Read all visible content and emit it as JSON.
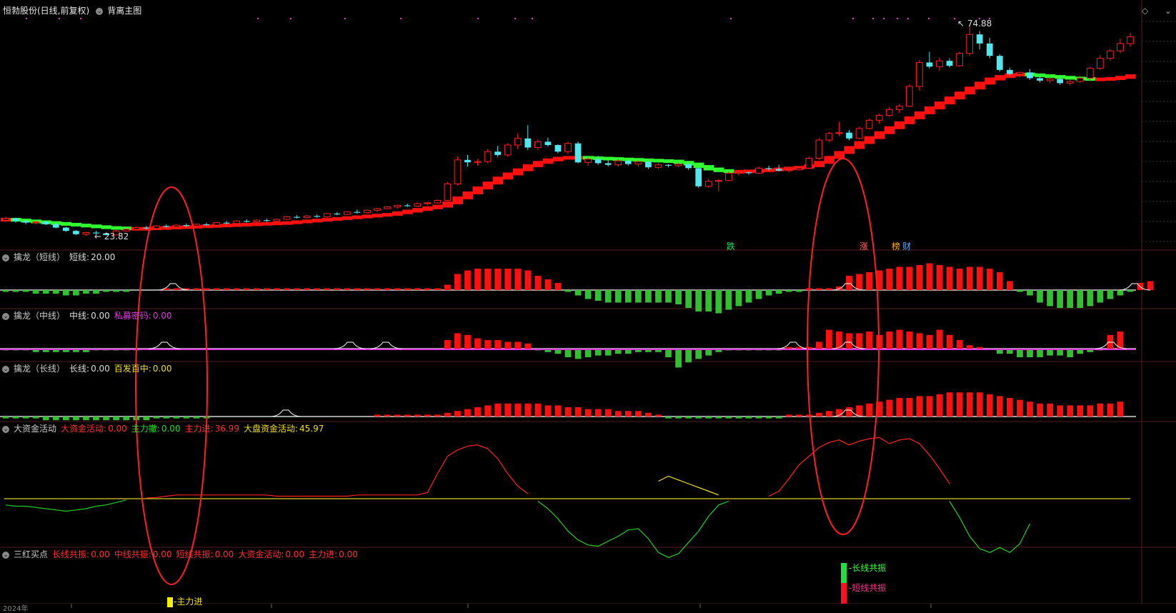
{
  "main": {
    "title": "恒勃股份(日线,前复权)",
    "overlay_label": "背离主图",
    "high_label": "74.88",
    "low_label": "23.82",
    "signals": [
      {
        "text": "跌",
        "color": "#1fdc5a"
      },
      {
        "text": "涨",
        "color": "#ff6a6a"
      },
      {
        "text": "榜",
        "color": "#ffb020"
      },
      {
        "text": "财",
        "color": "#5aa8ff"
      }
    ]
  },
  "panels": {
    "short": {
      "name": "擒龙（短线）",
      "items": [
        {
          "label": "短线:",
          "value": "20.00",
          "color": "#dddddd"
        }
      ]
    },
    "mid": {
      "name": "擒龙（中线）",
      "items": [
        {
          "label": "中线:",
          "value": "0.00",
          "color": "#dddddd"
        },
        {
          "label": "私募密码:",
          "value": "0.00",
          "color": "#e038e0"
        }
      ]
    },
    "long": {
      "name": "擒龙（长线）",
      "items": [
        {
          "label": "长线:",
          "value": "0.00",
          "color": "#dddddd"
        },
        {
          "label": "百发百中:",
          "value": "0.00",
          "color": "#f0e020"
        }
      ]
    },
    "funds": {
      "name": "大资金活动",
      "items": [
        {
          "label": "大资金活动:",
          "value": "0.00",
          "color": "#ff3030"
        },
        {
          "label": "主力撤:",
          "value": "0.00",
          "color": "#20e020"
        },
        {
          "label": "主力进:",
          "value": "36.99",
          "color": "#ff3030"
        },
        {
          "label": "大盘资金活动:",
          "value": "45.97",
          "color": "#f0e020"
        }
      ]
    },
    "buy": {
      "name": "三红买点",
      "items": [
        {
          "label": "长线共振:",
          "value": "0.00",
          "color": "#ff3030"
        },
        {
          "label": "中线共振:",
          "value": "0.00",
          "color": "#ff3030"
        },
        {
          "label": "短线共振:",
          "value": "0.00",
          "color": "#ff3030"
        },
        {
          "label": "大资金活动:",
          "value": "0.00",
          "color": "#ff3030"
        },
        {
          "label": "主力进:",
          "value": "0.00",
          "color": "#ff3030"
        }
      ]
    }
  },
  "legend": {
    "main_in": "-主力进",
    "long_res": "-长线共振",
    "short_res": "-短线共振"
  },
  "bottom_axis": {
    "year": "2024年"
  },
  "colors": {
    "up": "#ff2020",
    "down": "#50e8f0",
    "ma_up": "#ff1010",
    "ma_down": "#30ff30",
    "ellipse": "#ff2020"
  },
  "chart_data": {
    "type": "candlestick",
    "price_range": [
      23.82,
      74.88
    ],
    "candles": [
      [
        27.6,
        28.4,
        27.2,
        28.0
      ],
      [
        28.0,
        28.2,
        27.0,
        27.4
      ],
      [
        27.4,
        27.6,
        26.6,
        27.0
      ],
      [
        27.0,
        27.4,
        26.6,
        27.2
      ],
      [
        27.2,
        27.4,
        26.4,
        26.6
      ],
      [
        26.6,
        26.8,
        25.6,
        25.8
      ],
      [
        25.8,
        26.0,
        24.8,
        25.0
      ],
      [
        25.0,
        25.2,
        24.0,
        24.2
      ],
      [
        24.2,
        24.8,
        23.82,
        24.6
      ],
      [
        24.6,
        25.0,
        24.0,
        24.4
      ],
      [
        24.4,
        24.6,
        23.9,
        24.0
      ],
      [
        24.0,
        25.2,
        23.9,
        25.0
      ],
      [
        25.0,
        25.6,
        24.8,
        25.4
      ],
      [
        25.4,
        26.0,
        25.2,
        25.8
      ],
      [
        25.8,
        26.2,
        25.4,
        25.6
      ],
      [
        25.6,
        26.4,
        25.4,
        26.2
      ],
      [
        26.2,
        26.6,
        25.8,
        26.0
      ],
      [
        26.0,
        26.6,
        25.8,
        26.4
      ],
      [
        26.4,
        26.8,
        26.0,
        26.2
      ],
      [
        26.2,
        26.8,
        26.0,
        26.6
      ],
      [
        26.6,
        27.0,
        26.2,
        26.4
      ],
      [
        26.4,
        27.2,
        26.2,
        27.0
      ],
      [
        27.0,
        27.4,
        26.6,
        26.8
      ],
      [
        26.8,
        27.6,
        26.6,
        27.4
      ],
      [
        27.4,
        27.8,
        27.0,
        27.2
      ],
      [
        27.2,
        27.8,
        27.0,
        27.6
      ],
      [
        27.6,
        28.0,
        27.2,
        27.4
      ],
      [
        27.4,
        28.0,
        27.2,
        27.8
      ],
      [
        27.8,
        28.6,
        27.6,
        28.4
      ],
      [
        28.4,
        28.8,
        28.0,
        28.2
      ],
      [
        28.2,
        28.8,
        28.0,
        28.6
      ],
      [
        28.6,
        29.0,
        28.2,
        28.4
      ],
      [
        28.4,
        29.4,
        28.2,
        29.2
      ],
      [
        29.2,
        29.6,
        28.8,
        29.0
      ],
      [
        29.0,
        29.8,
        28.8,
        29.6
      ],
      [
        29.6,
        30.2,
        29.2,
        29.4
      ],
      [
        29.4,
        30.2,
        29.2,
        30.0
      ],
      [
        30.0,
        30.6,
        29.6,
        30.4
      ],
      [
        30.4,
        31.0,
        30.2,
        30.8
      ],
      [
        30.8,
        31.4,
        30.4,
        31.2
      ],
      [
        31.2,
        31.6,
        30.8,
        31.0
      ],
      [
        31.0,
        31.8,
        30.8,
        31.6
      ],
      [
        31.6,
        32.0,
        31.2,
        31.8
      ],
      [
        31.8,
        32.6,
        31.6,
        32.4
      ],
      [
        32.4,
        36.8,
        32.2,
        36.4
      ],
      [
        36.4,
        43.0,
        36.0,
        42.2
      ],
      [
        42.2,
        43.4,
        40.6,
        41.6
      ],
      [
        41.6,
        42.4,
        40.8,
        41.8
      ],
      [
        41.8,
        44.8,
        41.4,
        44.2
      ],
      [
        44.2,
        45.6,
        43.0,
        43.4
      ],
      [
        43.4,
        46.2,
        43.0,
        45.8
      ],
      [
        45.8,
        48.6,
        44.8,
        47.4
      ],
      [
        47.4,
        50.6,
        44.6,
        45.2
      ],
      [
        45.2,
        47.2,
        44.6,
        46.6
      ],
      [
        46.6,
        47.6,
        45.4,
        45.8
      ],
      [
        45.8,
        46.0,
        43.8,
        44.2
      ],
      [
        44.2,
        46.6,
        43.6,
        46.2
      ],
      [
        46.2,
        46.6,
        41.4,
        41.6
      ],
      [
        41.6,
        42.8,
        40.8,
        42.4
      ],
      [
        42.4,
        43.2,
        41.0,
        41.4
      ],
      [
        41.4,
        42.2,
        40.6,
        41.0
      ],
      [
        41.0,
        42.4,
        40.6,
        42.0
      ],
      [
        42.0,
        42.4,
        40.8,
        41.2
      ],
      [
        41.2,
        42.0,
        40.6,
        41.8
      ],
      [
        41.8,
        42.0,
        40.0,
        40.4
      ],
      [
        40.4,
        41.4,
        40.0,
        41.0
      ],
      [
        41.0,
        41.2,
        40.4,
        40.8
      ],
      [
        40.8,
        41.6,
        40.4,
        41.2
      ],
      [
        41.2,
        41.4,
        39.8,
        40.2
      ],
      [
        40.2,
        40.4,
        35.4,
        35.8
      ],
      [
        35.8,
        37.6,
        35.4,
        37.0
      ],
      [
        37.0,
        37.6,
        34.6,
        37.2
      ],
      [
        37.2,
        39.4,
        37.0,
        39.0
      ],
      [
        39.0,
        39.8,
        38.4,
        39.2
      ],
      [
        39.2,
        39.4,
        38.6,
        39.0
      ],
      [
        39.0,
        40.6,
        38.8,
        40.2
      ],
      [
        40.2,
        40.8,
        39.6,
        40.0
      ],
      [
        40.0,
        41.0,
        39.4,
        39.6
      ],
      [
        39.6,
        40.2,
        39.2,
        39.8
      ],
      [
        39.8,
        40.6,
        39.6,
        40.2
      ],
      [
        40.2,
        43.0,
        40.0,
        42.6
      ],
      [
        42.6,
        47.4,
        42.2,
        47.0
      ],
      [
        47.0,
        49.0,
        46.6,
        48.6
      ],
      [
        48.6,
        51.4,
        48.0,
        48.8
      ],
      [
        48.8,
        49.4,
        47.0,
        47.4
      ],
      [
        47.4,
        50.2,
        47.2,
        49.8
      ],
      [
        49.8,
        52.2,
        49.6,
        51.8
      ],
      [
        51.8,
        53.4,
        51.0,
        53.0
      ],
      [
        53.0,
        55.0,
        52.6,
        54.4
      ],
      [
        54.4,
        55.8,
        53.6,
        55.2
      ],
      [
        55.2,
        60.6,
        55.0,
        60.0
      ],
      [
        60.0,
        66.4,
        59.0,
        65.8
      ],
      [
        65.8,
        68.4,
        64.4,
        64.8
      ],
      [
        64.8,
        67.0,
        63.8,
        66.2
      ],
      [
        66.2,
        66.8,
        64.6,
        65.0
      ],
      [
        65.0,
        68.4,
        64.8,
        68.0
      ],
      [
        68.0,
        74.88,
        67.4,
        72.6
      ],
      [
        72.6,
        73.4,
        69.0,
        70.4
      ],
      [
        70.4,
        71.8,
        66.8,
        67.4
      ],
      [
        67.4,
        67.8,
        63.6,
        64.0
      ],
      [
        64.0,
        64.6,
        62.6,
        63.0
      ],
      [
        63.0,
        63.6,
        62.2,
        63.4
      ],
      [
        63.4,
        64.2,
        61.6,
        62.0
      ],
      [
        62.0,
        62.6,
        61.0,
        61.4
      ],
      [
        61.4,
        62.2,
        60.8,
        61.8
      ],
      [
        61.8,
        62.4,
        60.4,
        60.8
      ],
      [
        60.8,
        61.6,
        60.2,
        61.2
      ],
      [
        61.2,
        62.6,
        60.8,
        62.0
      ],
      [
        62.0,
        64.8,
        61.2,
        64.4
      ],
      [
        64.4,
        67.6,
        64.0,
        66.8
      ],
      [
        66.8,
        69.0,
        66.2,
        68.6
      ],
      [
        68.6,
        71.6,
        68.0,
        70.4
      ],
      [
        70.4,
        73.0,
        69.6,
        72.0
      ]
    ],
    "ma_line": [
      27.8,
      27.6,
      27.4,
      27.2,
      27.0,
      26.8,
      26.6,
      26.4,
      26.2,
      26.0,
      25.8,
      25.7,
      25.6,
      25.6,
      25.6,
      25.7,
      25.8,
      25.9,
      26.0,
      26.1,
      26.2,
      26.3,
      26.4,
      26.5,
      26.6,
      26.7,
      26.8,
      26.9,
      27.0,
      27.2,
      27.4,
      27.6,
      27.8,
      28.0,
      28.2,
      28.4,
      28.6,
      28.8,
      29.0,
      29.4,
      29.8,
      30.2,
      30.6,
      31.0,
      31.8,
      33.0,
      34.2,
      35.4,
      36.6,
      37.8,
      38.8,
      39.8,
      40.8,
      41.6,
      42.2,
      42.6,
      42.8,
      42.8,
      42.7,
      42.6,
      42.5,
      42.4,
      42.3,
      42.2,
      42.1,
      42.0,
      41.9,
      41.6,
      41.2,
      40.6,
      40.0,
      39.6,
      39.4,
      39.4,
      39.5,
      39.6,
      39.8,
      40.0,
      40.2,
      40.4,
      40.8,
      41.6,
      42.8,
      44.0,
      45.2,
      46.4,
      47.6,
      48.8,
      50.0,
      51.2,
      52.4,
      53.6,
      54.8,
      56.0,
      57.2,
      58.4,
      59.6,
      60.8,
      61.8,
      62.4,
      62.8,
      63.0,
      62.8,
      62.6,
      62.4,
      62.2,
      62.0,
      61.9,
      61.8,
      61.8,
      61.9,
      62.2,
      62.6,
      63.0,
      63.4
    ],
    "short_bars": [
      -1,
      -1,
      -1,
      -2,
      -2,
      -2,
      -3,
      -3,
      -2,
      -2,
      -1,
      -1,
      -1,
      0.5,
      0.5,
      0.5,
      1,
      1,
      1,
      1,
      1,
      1,
      1,
      1,
      1,
      1,
      1,
      1,
      1,
      1,
      1,
      1,
      1,
      1,
      1,
      1,
      1,
      1,
      1,
      1,
      1,
      1,
      1,
      1,
      3,
      9,
      11,
      12,
      12,
      12,
      12,
      12,
      11,
      8,
      6,
      4,
      -1,
      -3,
      -5,
      -6,
      -7,
      -7,
      -7,
      -7,
      -7,
      -7,
      -7,
      -8,
      -10,
      -12,
      -12,
      -13,
      -11,
      -9,
      -7,
      -5,
      -3,
      -2,
      -1,
      -1,
      1,
      1,
      1,
      2,
      8,
      9,
      10,
      11,
      12,
      13,
      13,
      14,
      15,
      14,
      13,
      12,
      13,
      13,
      12,
      10,
      5,
      -1,
      -3,
      -7,
      -9,
      -10,
      -10,
      -10,
      -9,
      -7,
      -5,
      -3,
      -1,
      4,
      5
    ],
    "mid_bars": [
      -1,
      -1,
      -1,
      -2,
      -2,
      -2,
      -2,
      -2,
      -2,
      -1,
      -1,
      -1,
      -1,
      -1,
      0.5,
      0.5,
      0.5,
      0.5,
      0.5,
      0.5,
      0.5,
      0.5,
      0.5,
      0.5,
      0.5,
      0.5,
      0.5,
      0.5,
      0.5,
      0.5,
      0.5,
      0.5,
      0.5,
      0.5,
      0.5,
      0.5,
      0.5,
      0.5,
      0.5,
      0.5,
      0.5,
      0.5,
      0.5,
      0.5,
      5,
      9,
      8,
      6,
      5,
      5,
      4,
      4,
      3,
      -1,
      -2,
      -3,
      -5,
      -6,
      -5,
      -4,
      -4,
      -3,
      -3,
      -2,
      -2,
      -2,
      -5,
      -11,
      -8,
      -6,
      -4,
      -2,
      -1,
      -1,
      -1,
      -1,
      -1,
      -1,
      1,
      1,
      1,
      4,
      11,
      10,
      9,
      9,
      10,
      8,
      10,
      11,
      10,
      9,
      8,
      11,
      8,
      5,
      2,
      1,
      0.5,
      -3,
      -3,
      -5,
      -5,
      -5,
      -4,
      -4,
      -5,
      -3,
      -2,
      -1,
      8,
      10
    ],
    "long_bars": [
      -1,
      -1,
      -1,
      -1,
      -2,
      -2,
      -2,
      -2,
      -2,
      -2,
      -2,
      -2,
      -2,
      -2,
      -2,
      -1,
      -1,
      -1,
      -1,
      -1,
      -1,
      0.5,
      0.5,
      0.5,
      0.5,
      0.5,
      0.5,
      0.5,
      0.5,
      0.5,
      0.5,
      0.5,
      0.5,
      0.5,
      0.5,
      0.5,
      0.5,
      1,
      1,
      1,
      1,
      1,
      1,
      1,
      2,
      3,
      4,
      5,
      6,
      7,
      7,
      7,
      7,
      7,
      6,
      6,
      5,
      5,
      4,
      4,
      4,
      3,
      3,
      3,
      2,
      1,
      -1,
      -1,
      -1,
      -1,
      -1,
      -1,
      -1,
      -1,
      -1,
      -1,
      -1,
      -1,
      1,
      1,
      1,
      2,
      3,
      4,
      5,
      6,
      7,
      8,
      9,
      10,
      10,
      11,
      11,
      12,
      13,
      13,
      13,
      13,
      12,
      11,
      10,
      9,
      8,
      7,
      7,
      6,
      6,
      6,
      6,
      7,
      7,
      8
    ],
    "funds_red": [
      0,
      0,
      0,
      0,
      0,
      0,
      0,
      0,
      0,
      0,
      0,
      0,
      0,
      0,
      0.5,
      1,
      2,
      3,
      3,
      3,
      3,
      3,
      3,
      3,
      3,
      3,
      3,
      2,
      2,
      2,
      2,
      2,
      2,
      2,
      2,
      3,
      3,
      3,
      3,
      3,
      3,
      3,
      5,
      20,
      34,
      39,
      42,
      43,
      40,
      32,
      20,
      10,
      4,
      0,
      0,
      0,
      0,
      0,
      0,
      0,
      0,
      0,
      0,
      0,
      0,
      0,
      0,
      0,
      0,
      0,
      0,
      0,
      0,
      0,
      0,
      0,
      2,
      6,
      16,
      27,
      34,
      41,
      45,
      47,
      43,
      46,
      48,
      49,
      44,
      47,
      48,
      44,
      35,
      24,
      12,
      0,
      0,
      0,
      0,
      0,
      0,
      0,
      0,
      0,
      0,
      0,
      0,
      0,
      0,
      0,
      0,
      0,
      0,
      0,
      0
    ],
    "funds_green": [
      -5,
      -6,
      -6,
      -7,
      -8,
      -9,
      -10,
      -9,
      -8,
      -6,
      -5,
      -3,
      -1,
      0,
      0,
      0,
      0,
      0,
      0,
      0,
      0,
      0,
      0,
      0,
      0,
      0,
      0,
      0,
      0,
      0,
      0,
      0,
      0,
      0,
      0,
      0,
      0,
      0,
      0,
      0,
      0,
      0,
      0,
      0,
      0,
      0,
      0,
      0,
      0,
      0,
      0,
      0,
      0,
      -2,
      -8,
      -16,
      -26,
      -33,
      -37,
      -38,
      -34,
      -30,
      -25,
      -24,
      -32,
      -43,
      -47,
      -44,
      -35,
      -26,
      -14,
      -5,
      -2,
      0,
      0,
      0,
      0,
      0,
      0,
      0,
      0,
      0,
      0,
      0,
      0,
      0,
      0,
      0,
      0,
      0,
      0,
      0,
      0,
      0,
      -2,
      -15,
      -30,
      -40,
      -43,
      -39,
      -43,
      -36,
      -20,
      0,
      5
    ],
    "funds_yellow": [
      0,
      0,
      0,
      0,
      0,
      0,
      0,
      0,
      0,
      0,
      0,
      0,
      0,
      0,
      0,
      0,
      0,
      0,
      0,
      0,
      0,
      0,
      0,
      0,
      0,
      0,
      0,
      0,
      0,
      0,
      0,
      0,
      0,
      0,
      0,
      0,
      0,
      0,
      0,
      0,
      0,
      0,
      0,
      0,
      0,
      0,
      0,
      0,
      0,
      0,
      0,
      0,
      0,
      0,
      0,
      0,
      0,
      0,
      0,
      0,
      0,
      0,
      0,
      0,
      0,
      14,
      18,
      15,
      12,
      9,
      6,
      3,
      0,
      0,
      0,
      0,
      0,
      0,
      0,
      0,
      0,
      0,
      0,
      0,
      0,
      0,
      0,
      0,
      0,
      0,
      0,
      0,
      0,
      0,
      0,
      0,
      0,
      0,
      0,
      0,
      0,
      0,
      0,
      0,
      0,
      0,
      0,
      0,
      0,
      0,
      0,
      0,
      0,
      0,
      0,
      0,
      12
    ]
  }
}
